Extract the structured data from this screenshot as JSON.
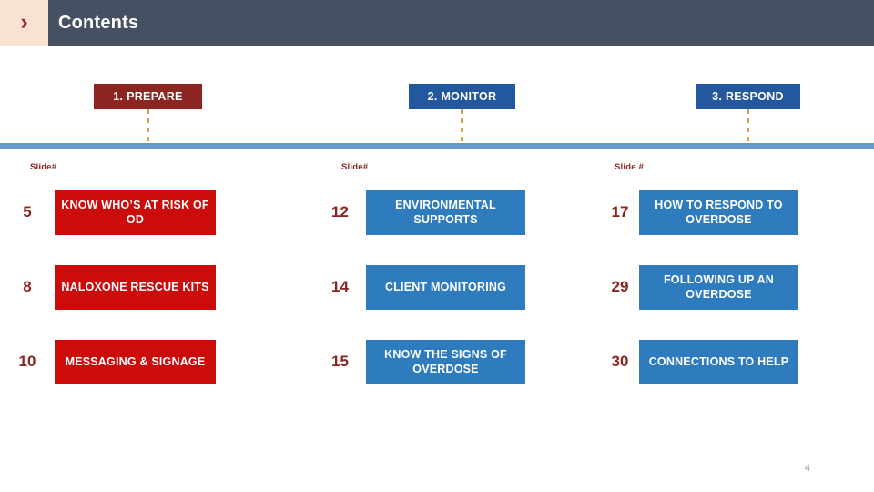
{
  "header": {
    "chevron_icon": "chevron-right-icon",
    "chevron_glyph": "›",
    "title": "Contents",
    "bar_color": "#455063",
    "accent_block_color": "#FAE2D2",
    "chevron_color": "#9E1B1B"
  },
  "divider": {
    "color": "#6699CC"
  },
  "phases": [
    {
      "label": "1. PREPARE",
      "color": "#8C2420"
    },
    {
      "label": "2. MONITOR",
      "color": "#23579E"
    },
    {
      "label": "3. RESPOND",
      "color": "#23579E"
    }
  ],
  "stem_color": "#C8A84B",
  "columns": [
    {
      "slide_header": "Slide#",
      "box_color": "#CC0B0B",
      "number_color": "#8C2420",
      "rows": [
        {
          "number": "5",
          "title": "KNOW WHO’S AT RISK OF OD"
        },
        {
          "number": "8",
          "title": "NALOXONE RESCUE KITS"
        },
        {
          "number": "10",
          "title": "MESSAGING & SIGNAGE"
        }
      ]
    },
    {
      "slide_header": "Slide#",
      "box_color": "#2E7CBE",
      "number_color": "#8C2420",
      "rows": [
        {
          "number": "12",
          "title": "ENVIRONMENTAL SUPPORTS"
        },
        {
          "number": "14",
          "title": "CLIENT MONITORING"
        },
        {
          "number": "15",
          "title": "KNOW THE SIGNS OF OVERDOSE"
        }
      ]
    },
    {
      "slide_header": "Slide #",
      "box_color": "#2E7CBE",
      "number_color": "#8C2420",
      "rows": [
        {
          "number": "17",
          "title": "HOW TO RESPOND TO OVERDOSE"
        },
        {
          "number": "29",
          "title": "FOLLOWING UP AN OVERDOSE"
        },
        {
          "number": "30",
          "title": "CONNECTIONS TO HELP"
        }
      ]
    }
  ],
  "footer": {
    "page_number": "4"
  }
}
